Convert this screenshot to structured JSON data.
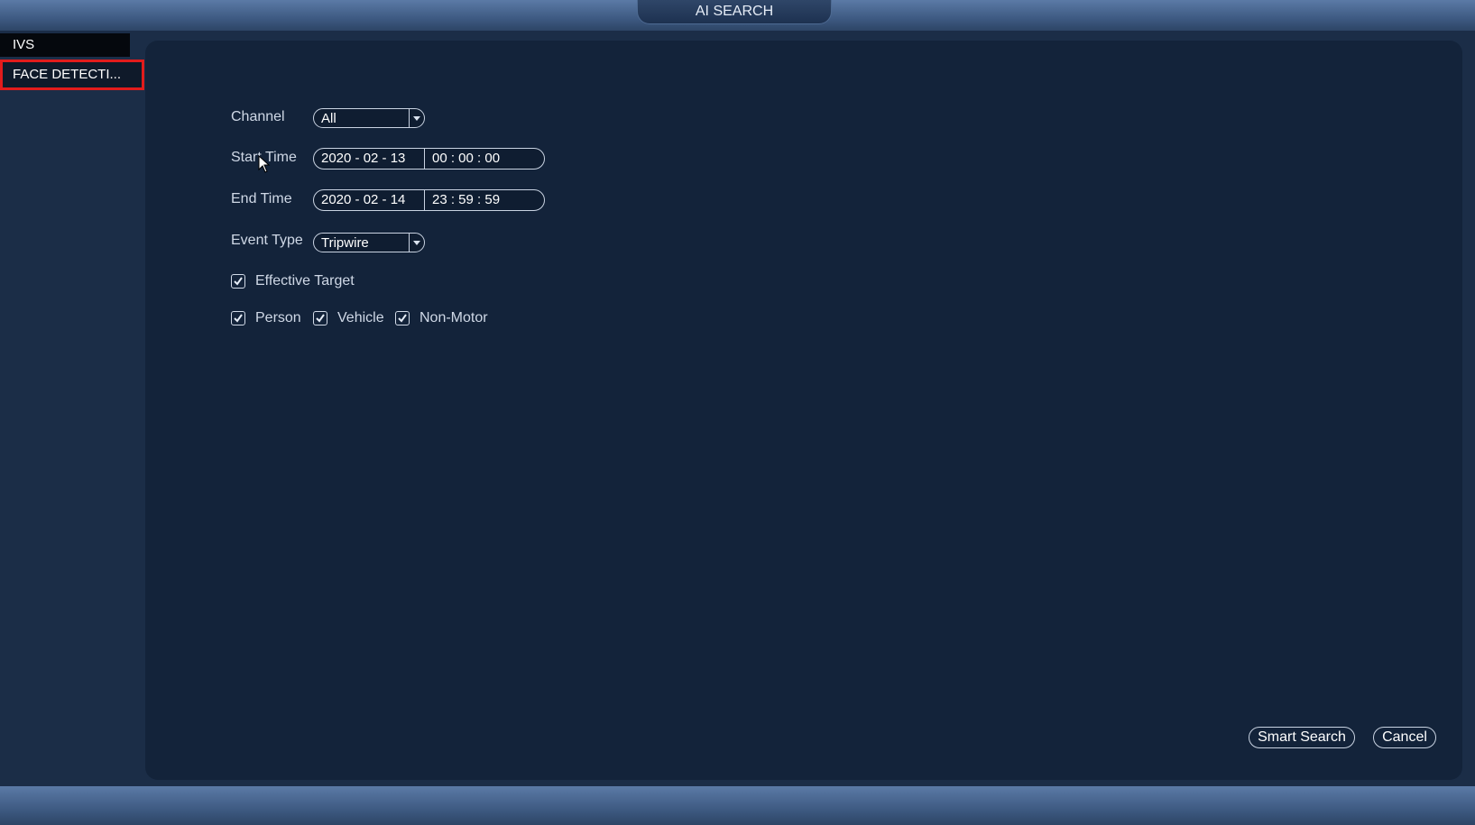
{
  "header": {
    "title": "AI SEARCH"
  },
  "sidebar": {
    "items": [
      {
        "label": "IVS"
      },
      {
        "label": "FACE DETECTI..."
      }
    ]
  },
  "form": {
    "channel": {
      "label": "Channel",
      "value": "All"
    },
    "start_time": {
      "label": "Start Time",
      "date": "2020  - 02 - 13",
      "time": "00 : 00 : 00"
    },
    "end_time": {
      "label": "End Time",
      "date": "2020  - 02 - 14",
      "time": "23 : 59 : 59"
    },
    "event_type": {
      "label": "Event Type",
      "value": "Tripwire"
    },
    "effective_target": {
      "label": "Effective Target",
      "checked": true
    },
    "targets": [
      {
        "label": "Person",
        "checked": true
      },
      {
        "label": "Vehicle",
        "checked": true
      },
      {
        "label": "Non-Motor",
        "checked": true
      }
    ]
  },
  "buttons": {
    "smart_search": "Smart Search",
    "cancel": "Cancel"
  },
  "colors": {
    "background": "#1b2d47",
    "panel": "#13233a",
    "highlight_border": "#e21c1c",
    "bar": "#4a6890"
  }
}
